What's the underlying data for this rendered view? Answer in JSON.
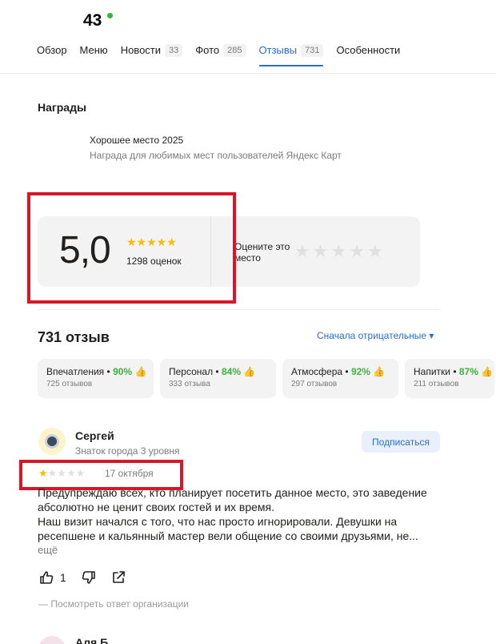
{
  "header": {
    "title": "43"
  },
  "tabs": [
    {
      "label": "Обзор",
      "count": ""
    },
    {
      "label": "Меню",
      "count": ""
    },
    {
      "label": "Новости",
      "count": "33"
    },
    {
      "label": "Фото",
      "count": "285"
    },
    {
      "label": "Отзывы",
      "count": "731",
      "active": true
    },
    {
      "label": "Особенности",
      "count": ""
    }
  ],
  "awards": {
    "title": "Награды",
    "name": "Хорошее место 2025",
    "description": "Награда для любимых мест пользователей Яндекс Карт"
  },
  "rating": {
    "value": "5,0",
    "stars": "★★★★★",
    "count": "1298 оценок",
    "rate_prompt": "Оцените это место",
    "rate_stars": [
      "★",
      "★",
      "★",
      "★",
      "★"
    ]
  },
  "reviews": {
    "count": "731 отзыв",
    "sort": "Сначала отрицательные ▾"
  },
  "aspects": [
    {
      "name": "Впечатления",
      "pct": "90%",
      "sub": "725 отзывов"
    },
    {
      "name": "Персонал",
      "pct": "84%",
      "sub": "333 отзыва"
    },
    {
      "name": "Атмосфера",
      "pct": "92%",
      "sub": "297 отзывов"
    },
    {
      "name": "Напитки",
      "pct": "87%",
      "sub": "211 отзывов"
    }
  ],
  "review": {
    "author": "Сергей",
    "level": "Знаток города 3 уровня",
    "subscribe": "Подписаться",
    "rating": 1,
    "stars_filled": "★",
    "stars_empty": "★★★★",
    "date": "17 октября",
    "text": [
      "Предупреждаю всех, кто планирует посетить данное место, это заведение абсолютно не ценит своих гостей и их время.",
      "Наш визит начался с того, что нас просто игнорировали. Девушки на ресепшене и кальянный мастер вели общение со своими друзьями, не..."
    ],
    "more": "ещё",
    "likes": "1",
    "reply": "— Посмотреть ответ организации"
  },
  "next_review": {
    "author": "Аля Б."
  },
  "colors": {
    "accent": "#2a6ecf",
    "star": "#fbbc05",
    "positive": "#3bb33b",
    "highlight": "#d6172a"
  }
}
